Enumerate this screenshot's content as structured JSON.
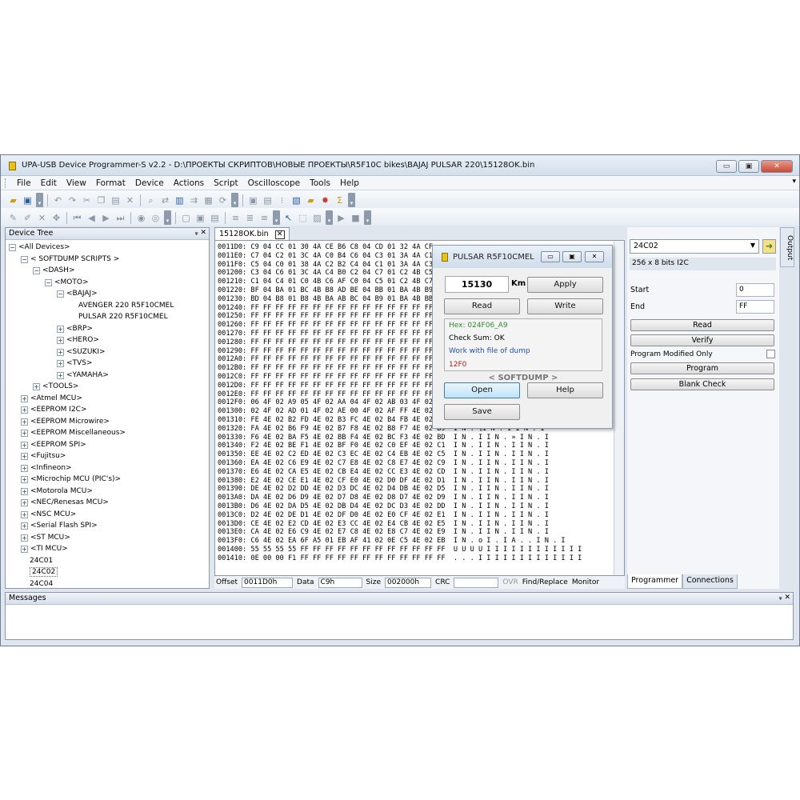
{
  "window": {
    "title": "UPA-USB Device Programmer-S v2.2 - D:\\ПРОЕКТЫ СКРИПТОВ\\НОВЫЕ ПРОЕКТЫ\\R5F10C bikes\\BAJAJ PULSAR 220\\15128OK.bin",
    "minimize": "▭",
    "maximize": "▣",
    "close": "✕"
  },
  "menu": [
    "File",
    "Edit",
    "View",
    "Format",
    "Device",
    "Actions",
    "Script",
    "Oscilloscope",
    "Tools",
    "Help"
  ],
  "device_tree": {
    "title": "Device Tree",
    "pin": "ᵩ",
    "close": "✕",
    "nodes": [
      {
        "label": "<All Devices>",
        "sign": "−"
      },
      {
        "label": "< SOFTDUMP SCRIPTS >",
        "sign": "−"
      },
      {
        "label": "<DASH>",
        "sign": "−"
      },
      {
        "label": "<MOTO>",
        "sign": "−"
      },
      {
        "label": "<BAJAJ>",
        "sign": "−"
      },
      {
        "label": "AVENGER 220 R5F10CMEL",
        "sign": ""
      },
      {
        "label": "PULSAR 220 R5F10CMEL",
        "sign": ""
      },
      {
        "label": "<BRP>",
        "sign": "+"
      },
      {
        "label": "<HERO>",
        "sign": "+"
      },
      {
        "label": "<SUZUKI>",
        "sign": "+"
      },
      {
        "label": "<TVS>",
        "sign": "+"
      },
      {
        "label": "<YAMAHA>",
        "sign": "+"
      },
      {
        "label": "<TOOLS>",
        "sign": "+"
      },
      {
        "label": "<Atmel MCU>",
        "sign": "+"
      },
      {
        "label": "<EEPROM I2C>",
        "sign": "+"
      },
      {
        "label": "<EEPROM Microwire>",
        "sign": "+"
      },
      {
        "label": "<EEPROM Miscellaneous>",
        "sign": "+"
      },
      {
        "label": "<EEPROM SPI>",
        "sign": "+"
      },
      {
        "label": "<Fujitsu>",
        "sign": "+"
      },
      {
        "label": "<Infineon>",
        "sign": "+"
      },
      {
        "label": "<Microchip MCU (PIC's)>",
        "sign": "+"
      },
      {
        "label": "<Motorola MCU>",
        "sign": "+"
      },
      {
        "label": "<NEC/Renesas MCU>",
        "sign": "+"
      },
      {
        "label": "<NSC MCU>",
        "sign": "+"
      },
      {
        "label": "<Serial Flash SPI>",
        "sign": "+"
      },
      {
        "label": "<ST MCU>",
        "sign": "+"
      },
      {
        "label": "<TI MCU>",
        "sign": "+"
      },
      {
        "label": "24C01",
        "sign": ""
      },
      {
        "label": "24C02",
        "sign": ""
      },
      {
        "label": "24C04",
        "sign": ""
      }
    ]
  },
  "doc_tab": {
    "label": "15128OK.bin",
    "close": "✕"
  },
  "hex_rows": [
    "0011D0: C9 04 CC 01 30 4A CE B6 C8 04 CD 01 32 4A CF",
    "0011E0: C7 04 C2 01 3C 4A C0 B4 C6 04 C3 01 3A 4A C1",
    "0011F0: C5 04 C0 01 38 4A C2 B2 C4 04 C1 01 3A 4A C3",
    "001200: C3 04 C6 01 3C 4A C4 B0 C2 04 C7 01 C2 4B C5",
    "001210: C1 04 C4 01 C0 4B C6 AF C0 04 C5 01 C2 4B C7",
    "001220: BF 04 BA 01 BC 4B B8 AD BE 04 BB 01 BA 4B B9",
    "001230: BD 04 B8 01 B8 4B BA AB BC 04 B9 01 BA 4B BB",
    "001240: FF FF FF FF FF FF FF FF FF FF FF FF FF FF FF",
    "001250: FF FF FF FF FF FF FF FF FF FF FF FF FF FF FF",
    "001260: FF FF FF FF FF FF FF FF FF FF FF FF FF FF FF",
    "001270: FF FF FF FF FF FF FF FF FF FF FF FF FF FF FF",
    "001280: FF FF FF FF FF FF FF FF FF FF FF FF FF FF FF",
    "001290: FF FF FF FF FF FF FF FF FF FF FF FF FF FF FF",
    "0012A0: FF FF FF FF FF FF FF FF FF FF FF FF FF FF FF",
    "0012B0: FF FF FF FF FF FF FF FF FF FF FF FF FF FF FF",
    "0012C0: FF FF FF FF FF FF FF FF FF FF FF FF FF FF FF",
    "0012D0: FF FF FF FF FF FF FF FF FF FF FF FF FF FF FF",
    "0012E0: FF FF FF FF FF FF FF FF FF FF FF FF FF FF FF",
    "0012F0: 06 4F 02 A9 05 4F 02 AA 04 4F 02 AB 03 4F 02",
    "001300: 02 4F 02 AD 01 4F 02 AE 00 4F 02 AF FF 4E 02",
    "001310: FE 4E 02 B2 FD 4E 02 B3 FC 4E 02 B4 FB 4E 02",
    "001320: FA 4E 02 B6 F9 4E 02 B7 F8 4E 02 B8 F7 4E 02 B9  I N . ¶I N . I I N . I",
    "001330: F6 4E 02 BA F5 4E 02 BB F4 4E 02 BC F3 4E 02 BD  I N . I I N . » I N . I",
    "001340: F2 4E 02 BE F1 4E 02 BF F0 4E 02 C0 EF 4E 02 C1  I N . I I N . I I N . I",
    "001350: EE 4E 02 C2 ED 4E 02 C3 EC 4E 02 C4 EB 4E 02 C5  I N . I I N . I I N . I",
    "001360: EA 4E 02 C6 E9 4E 02 C7 E8 4E 02 C8 E7 4E 02 C9  I N . I I N . I I N . I",
    "001370: E6 4E 02 CA E5 4E 02 CB E4 4E 02 CC E3 4E 02 CD  I N . I I N . I I N . I",
    "001380: E2 4E 02 CE E1 4E 02 CF E0 4E 02 D0 DF 4E 02 D1  I N . I I N . I I N . I",
    "001390: DE 4E 02 D2 DD 4E 02 D3 DC 4E 02 D4 DB 4E 02 D5  I N . I I N . I I N . I",
    "0013A0: DA 4E 02 D6 D9 4E 02 D7 D8 4E 02 D8 D7 4E 02 D9  I N . I I N . I I N . I",
    "0013B0: D6 4E 02 DA D5 4E 02 DB D4 4E 02 DC D3 4E 02 DD  I N . I I N . I I N . I",
    "0013C0: D2 4E 02 DE D1 4E 02 DF D0 4E 02 E0 CF 4E 02 E1  I N . I I N . I I N . I",
    "0013D0: CE 4E 02 E2 CD 4E 02 E3 CC 4E 02 E4 CB 4E 02 E5  I N . I I N . I I N . I",
    "0013E0: CA 4E 02 E6 C9 4E 02 E7 C8 4E 02 E8 C7 4E 02 E9  I N . I I N . I I N . I",
    "0013F0: C6 4E 02 EA 6F A5 01 EB AF 41 02 0E C5 4E 02 EB  I N . o I . I A . . I N . I",
    "001400: 55 55 55 55 FF FF FF FF FF FF FF FF FF FF FF FF  U U U U I I I I I I I I I I I I",
    "001410: 0E 00 00 F1 FF FF FF FF FF FF FF FF FF FF FF FF  . . . I I I I I I I I I I I I I"
  ],
  "statusbar": {
    "offset_label": "Offset",
    "offset_value": "0011D0h",
    "data_label": "Data",
    "data_value": "C9h",
    "size_label": "Size",
    "size_value": "002000h",
    "crc_label": "CRC",
    "crc_value": "",
    "ovr": "OVR",
    "find_replace": "Find/Replace",
    "monitor": "Monitor"
  },
  "dialog": {
    "title": "PULSAR R5F10CMEL",
    "km_value": "15130",
    "km_label": "Km",
    "apply": "Apply",
    "read": "Read",
    "write": "Write",
    "hex_line": "Hex: 024F06_A9",
    "checksum_line": "Check Sum: OK",
    "work_line": "Work with file of dump",
    "code_line": "12F0",
    "brand": "< SOFTDUMP >",
    "open": "Open",
    "help": "Help",
    "save": "Save",
    "colors": {
      "hex": "#2e8b2e",
      "work": "#2050b0",
      "code": "#b02020"
    }
  },
  "programmer": {
    "device": "24C02",
    "info": "256 x 8 bits I2C",
    "start_label": "Start",
    "start_value": "0",
    "end_label": "End",
    "end_value": "FF",
    "read": "Read",
    "verify": "Verify",
    "modified_only": "Program Modified Only",
    "program": "Program",
    "blank_check": "Blank Check",
    "tabs": [
      "Programmer",
      "Connections"
    ]
  },
  "output_tab": "Output",
  "messages": {
    "title": "Messages"
  }
}
